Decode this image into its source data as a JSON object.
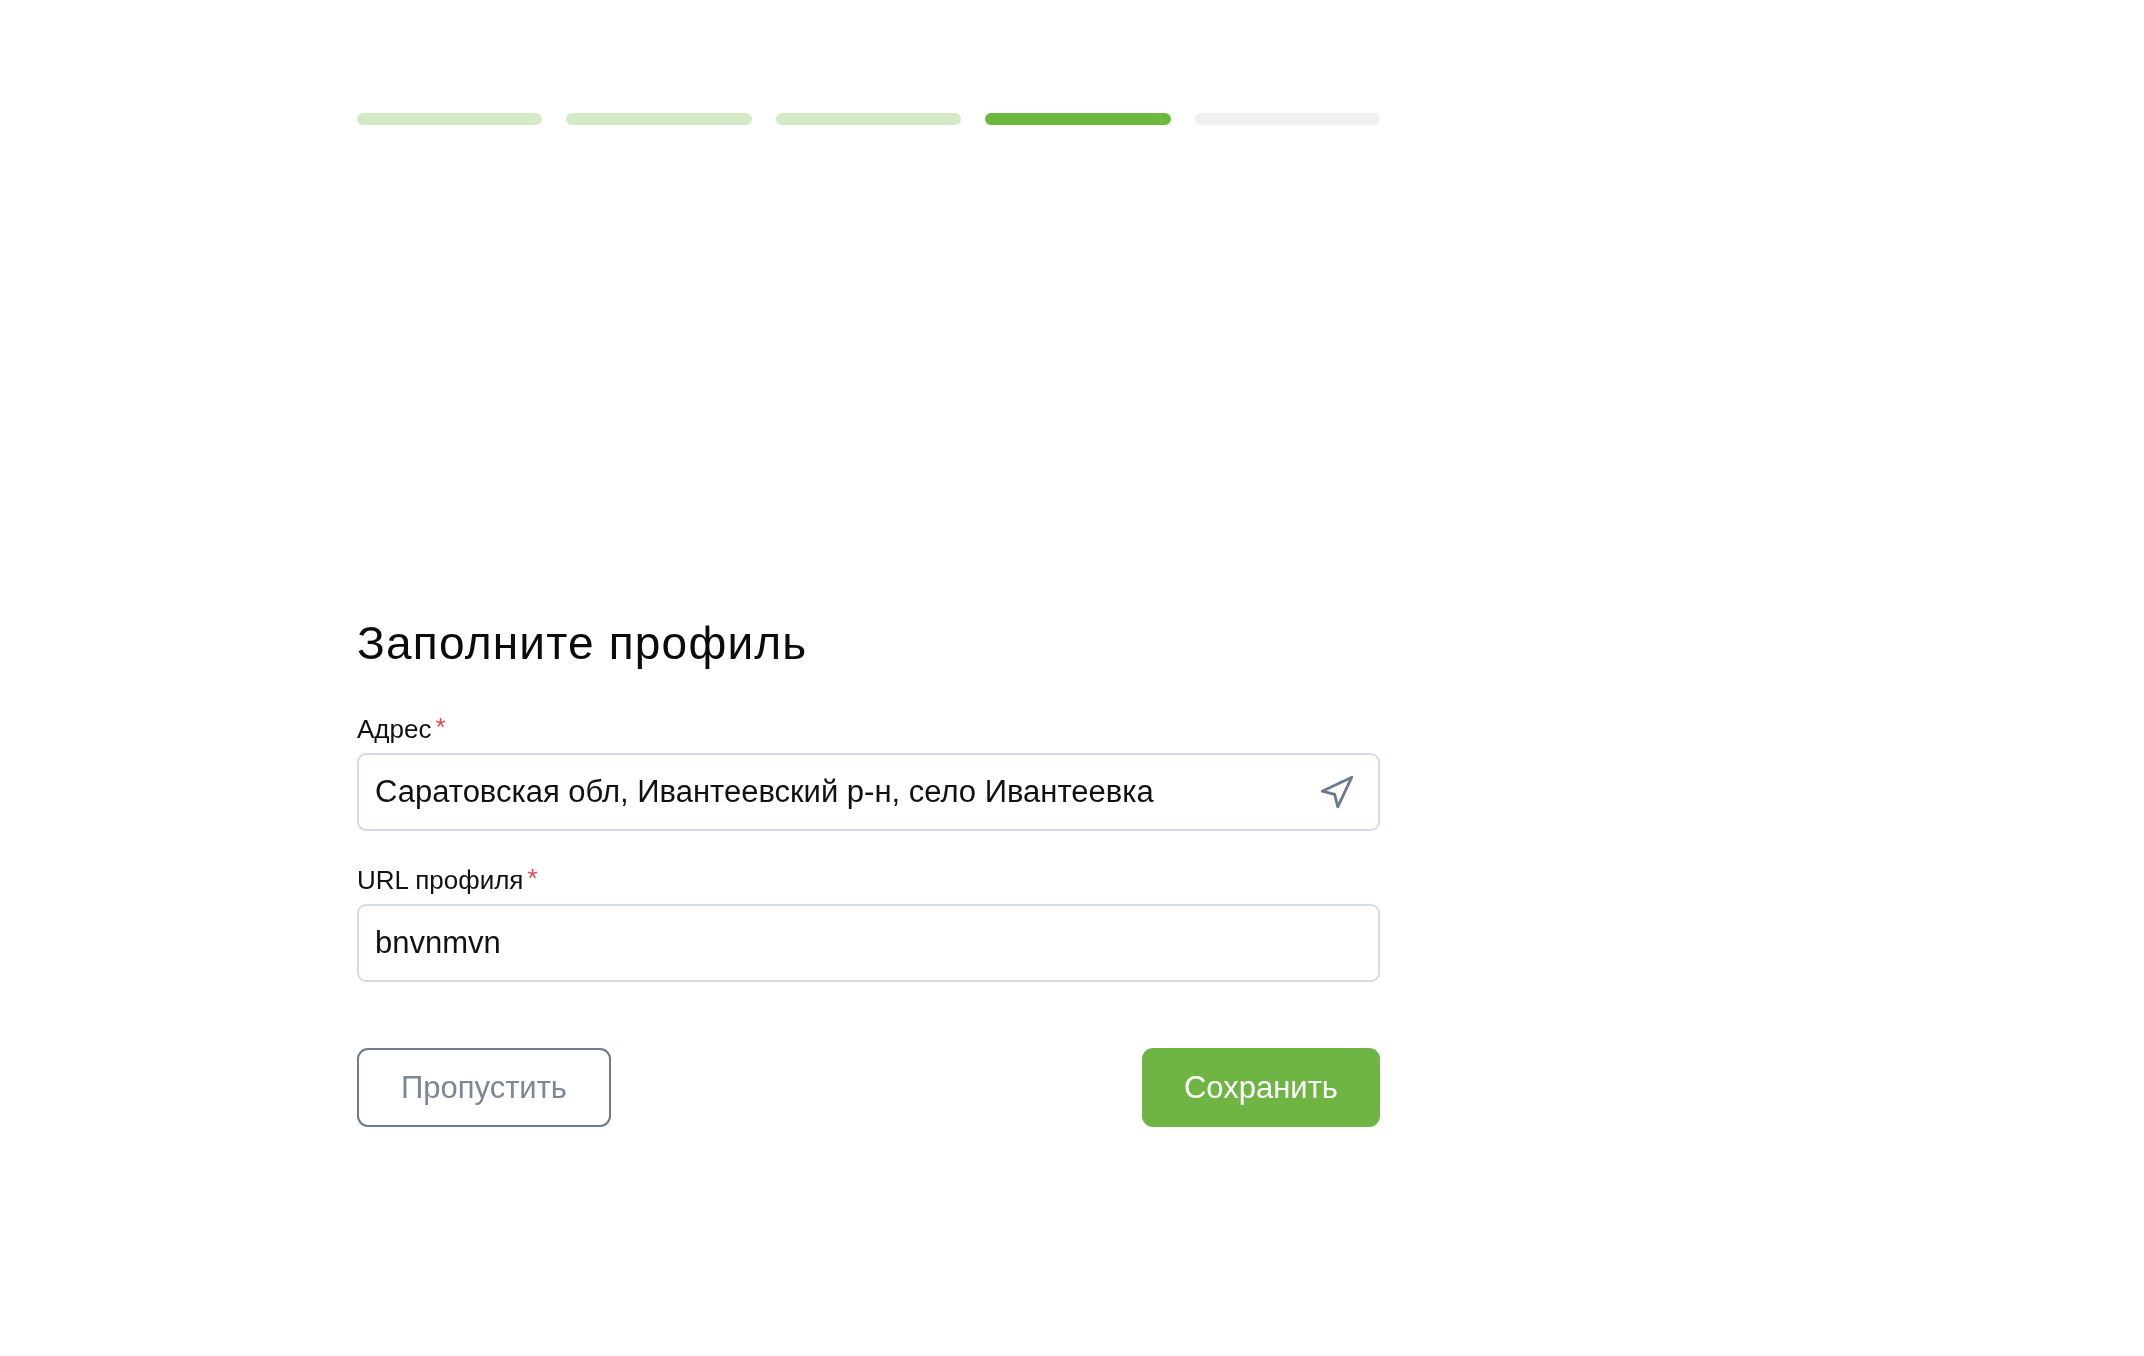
{
  "progress": {
    "steps": [
      {
        "completed": true,
        "selected": false
      },
      {
        "completed": true,
        "selected": false
      },
      {
        "completed": true,
        "selected": false
      },
      {
        "completed": false,
        "selected": true
      },
      {
        "completed": false,
        "selected": false
      }
    ]
  },
  "form": {
    "title": "Заполните профиль",
    "fields": [
      {
        "kind": "address",
        "label": "Адрес",
        "required_mark": "*",
        "value": "Саратовская обл, Ивантеевский р-н, село Ивантеевка"
      },
      {
        "kind": "text",
        "label": "URL профиля",
        "required_mark": "*",
        "value": "bnvnmvn"
      }
    ],
    "buttons": [
      {
        "kind": "secondary",
        "label": "Пропустить"
      },
      {
        "kind": "primary",
        "label": "Сохранить"
      }
    ]
  }
}
